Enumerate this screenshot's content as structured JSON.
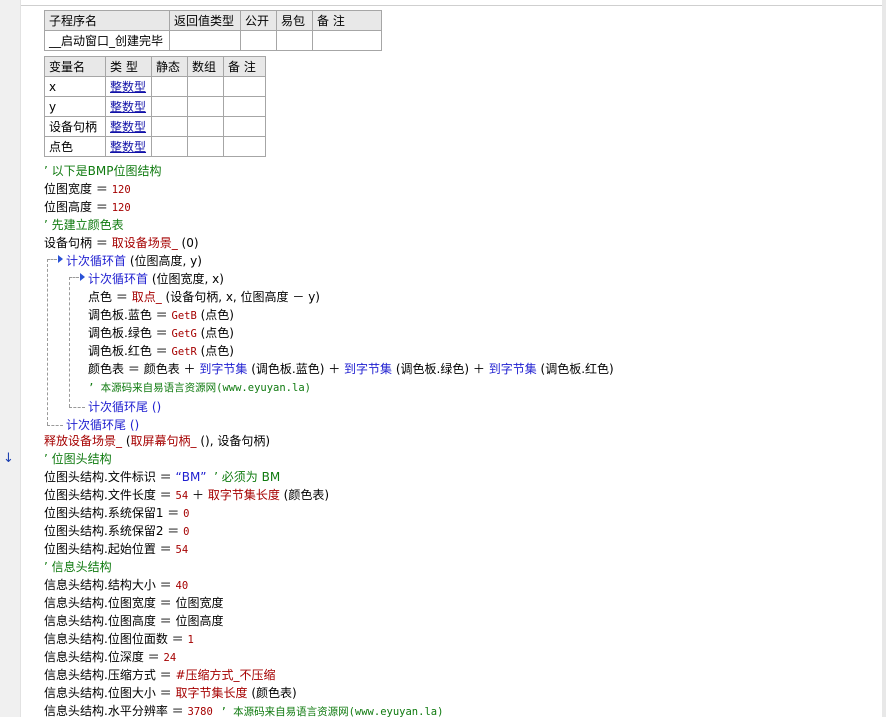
{
  "sub_table": {
    "headers": [
      "子程序名",
      "返回值类型",
      "公开",
      "易包",
      "备 注"
    ],
    "row": [
      "__启动窗口_创建完毕",
      "",
      "",
      "",
      ""
    ]
  },
  "var_table": {
    "headers": [
      "变量名",
      "类 型",
      "静态",
      "数组",
      "备 注"
    ],
    "rows": [
      [
        "x",
        "整数型"
      ],
      [
        "y",
        "整数型"
      ],
      [
        "设备句柄",
        "整数型"
      ],
      [
        "点色",
        "整数型"
      ]
    ]
  },
  "code": {
    "l1": "’ 以下是BMP位图结构",
    "l2a": "位图宽度",
    "l2b": "120",
    "l3a": "位图高度",
    "l3b": "120",
    "l4": "’ 先建立颜色表",
    "l5a": "设备句柄",
    "l5b": "取设备场景_",
    "l5c": " (0)",
    "l6a": "计次循环首",
    "l6b": " (位图高度, y)",
    "l7a": "计次循环首",
    "l7b": " (位图宽度, x)",
    "l8a": "点色",
    "l8b": "取点_",
    "l8c": " (设备句柄, x, 位图高度 － y)",
    "l9a": "调色板.蓝色",
    "l9b": "GetB",
    "l9c": " (点色)",
    "l10a": "调色板.绿色",
    "l10b": "GetG",
    "l10c": " (点色)",
    "l11a": "调色板.红色",
    "l11b": "GetR",
    "l11c": " (点色)",
    "l12a": "颜色表",
    "l12b": "颜色表",
    "l12c": "到字节集",
    "l12d": " (调色板.蓝色) ",
    "l12e": "到字节集",
    "l12f": " (调色板.绿色) ",
    "l12g": "到字节集",
    "l12h": " (调色板.红色)",
    "l13": "’ 本源码来自易语言资源网(www.eyuyan.la)",
    "l14": "计次循环尾 ()",
    "l15": "计次循环尾 ()",
    "l16a": "释放设备场景_",
    "l16b": " (",
    "l16c": "取屏幕句柄_",
    "l16d": " (), 设备句柄)",
    "l17": "’ 位图头结构",
    "l18a": "位图头结构.文件标识",
    "l18b": "“BM”",
    "l18c": "’ 必须为 BM",
    "l19a": "位图头结构.文件长度",
    "l19b": "54",
    "l19c": "取字节集长度",
    "l19d": " (颜色表)",
    "l20a": "位图头结构.系统保留1",
    "l20b": "0",
    "l21a": "位图头结构.系统保留2",
    "l21b": "0",
    "l22a": "位图头结构.起始位置",
    "l22b": "54",
    "l23": "’ 信息头结构",
    "l24a": "信息头结构.结构大小",
    "l24b": "40",
    "l25a": "信息头结构.位图宽度",
    "l25b": "位图宽度",
    "l26a": "信息头结构.位图高度",
    "l26b": "位图高度",
    "l27a": "信息头结构.位图位面数",
    "l27b": "1",
    "l28a": "信息头结构.位深度",
    "l28b": "24",
    "l29a": "信息头结构.压缩方式",
    "l29b": "#压缩方式_不压缩",
    "l30a": "信息头结构.位图大小",
    "l30b": "取字节集长度",
    "l30c": " (颜色表)",
    "l31a": "信息头结构.水平分辨率",
    "l31b": "3780",
    "l31c": "’ 本源码来自易语言资源网(www.eyuyan.la)"
  },
  "operators": {
    "assign": "＝",
    "plus": "＋"
  },
  "marker_icon": "down-arrow-icon"
}
